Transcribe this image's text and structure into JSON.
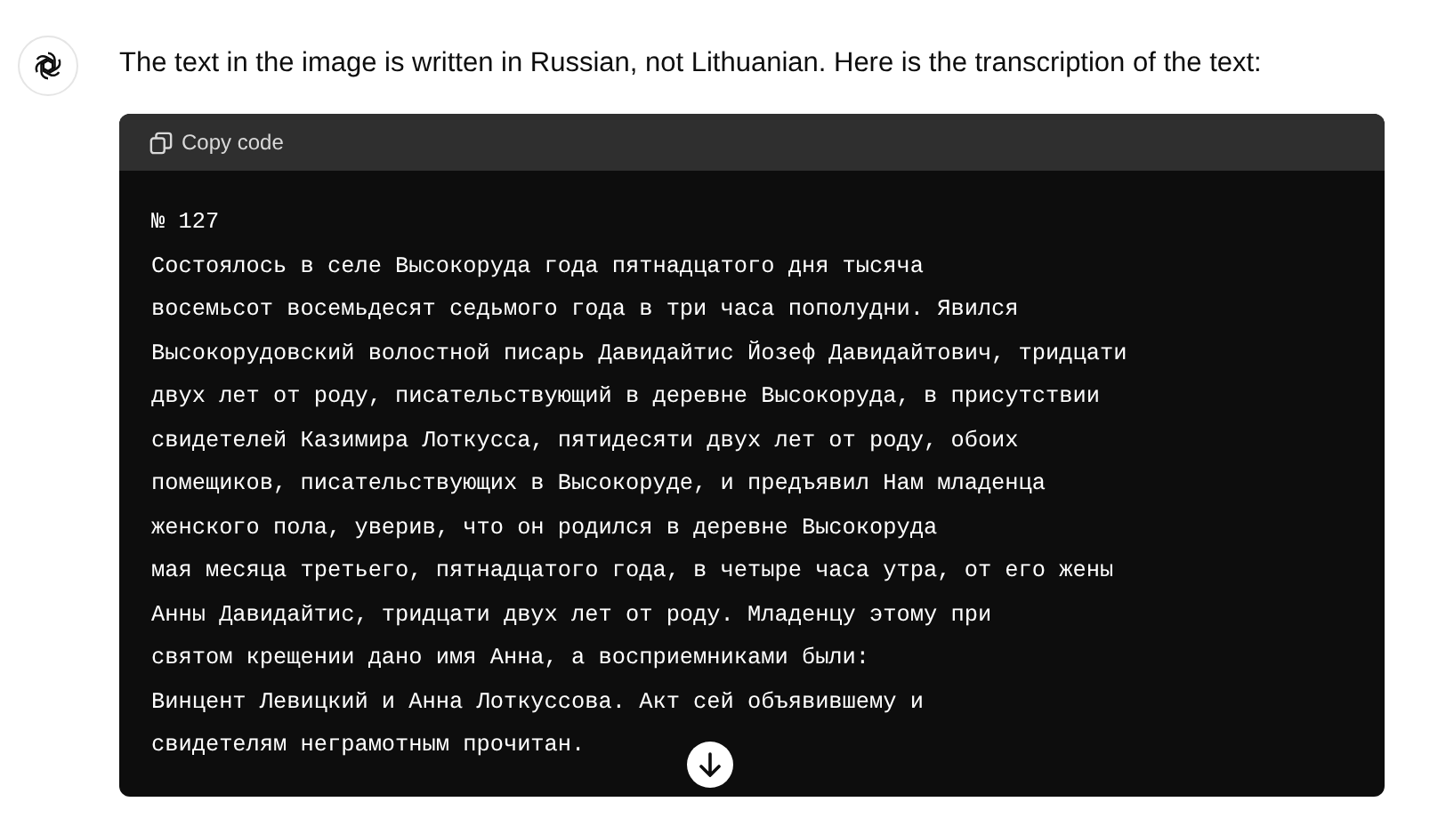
{
  "message": {
    "text": "The text in the image is written in Russian, not Lithuanian. Here is the transcription of the text:"
  },
  "code_block": {
    "copy_label": "Copy code",
    "lines": [
      "№ 127",
      "Состоялось в селе Высокоруда года пятнадцатого дня тысяча",
      "восемьсот восемьдесят седьмого года в три часа пополудни. Явился",
      "Высокорудовский волостной писарь Давидайтис Йозеф Давидайтович, тридцати",
      "двух лет от роду, писательствующий в деревне Высокоруда, в присутствии",
      "свидетелей Казимира Лоткусса, пятидесяти двух лет от роду, обоих",
      "помещиков, писательствующих в Высокоруде, и предъявил Нам младенца",
      "женского пола, уверив, что он родился в деревне Высокоруда",
      "мая месяца третьего, пятнадцатого года, в четыре часа утра, от его жены",
      "Анны Давидайтис, тридцати двух лет от роду. Младенцу этому при",
      "святом крещении дано имя Анна, а восприемниками были:",
      "Винцент Левицкий и Анна Лоткуссова. Акт сей объявившему и",
      "свидетелям неграмотным прочитан."
    ]
  }
}
